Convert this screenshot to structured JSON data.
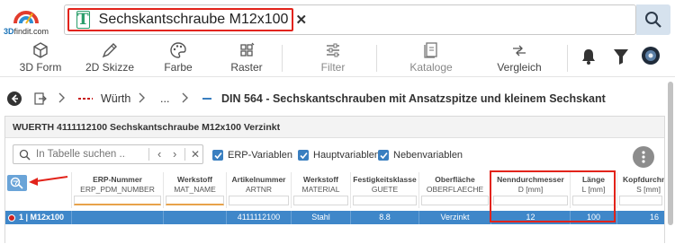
{
  "logo": {
    "brand": "3Dfindit.com"
  },
  "search": {
    "query": "Sechskantschraube M12x100",
    "chip_icon": "text-T-icon"
  },
  "toolbar": {
    "items": [
      {
        "label": "3D Form",
        "icon": "cube-icon"
      },
      {
        "label": "2D Skizze",
        "icon": "sketch-icon"
      },
      {
        "label": "Farbe",
        "icon": "palette-icon"
      },
      {
        "label": "Raster",
        "icon": "raster-icon"
      },
      {
        "label": "Filter",
        "icon": "sliders-icon"
      },
      {
        "label": "Kataloge",
        "icon": "catalog-icon"
      },
      {
        "label": "Vergleich",
        "icon": "compare-icon"
      }
    ]
  },
  "breadcrumb": {
    "items": [
      "Würth",
      "..."
    ],
    "title": "DIN 564 - Sechskantschrauben mit Ansatzspitze und kleinem Sechskant"
  },
  "panel": {
    "title": "WUERTH 4111112100 Sechskantschraube M12x100 Verzinkt",
    "table_search_placeholder": "In Tabelle suchen ...",
    "checkboxes": [
      "ERP-Variablen",
      "Hauptvariablen",
      "Nebenvariablen"
    ]
  },
  "table": {
    "columns": [
      {
        "title": "ERP-Nummer",
        "sub": "ERP_PDM_NUMBER"
      },
      {
        "title": "Werkstoff",
        "sub": "MAT_NAME"
      },
      {
        "title": "Artikelnummer",
        "sub": "ARTNR"
      },
      {
        "title": "Werkstoff",
        "sub": "MATERIAL"
      },
      {
        "title": "Festigkeitsklasse",
        "sub": "GUETE"
      },
      {
        "title": "Oberfläche",
        "sub": "OBERFLAECHE"
      },
      {
        "title": "Nenndurchmesser",
        "sub": "D [mm]"
      },
      {
        "title": "Länge",
        "sub": "L [mm]"
      },
      {
        "title": "Kopfdurchm",
        "sub": "S [mm]"
      }
    ],
    "row": {
      "label": "1 | M12x100",
      "cells": [
        "",
        "",
        "4111112100",
        "Stahl",
        "8.8",
        "Verzinkt",
        "12",
        "100",
        "16"
      ]
    }
  },
  "colors": {
    "accent": "#3f87c9",
    "highlight": "#e2231a"
  }
}
